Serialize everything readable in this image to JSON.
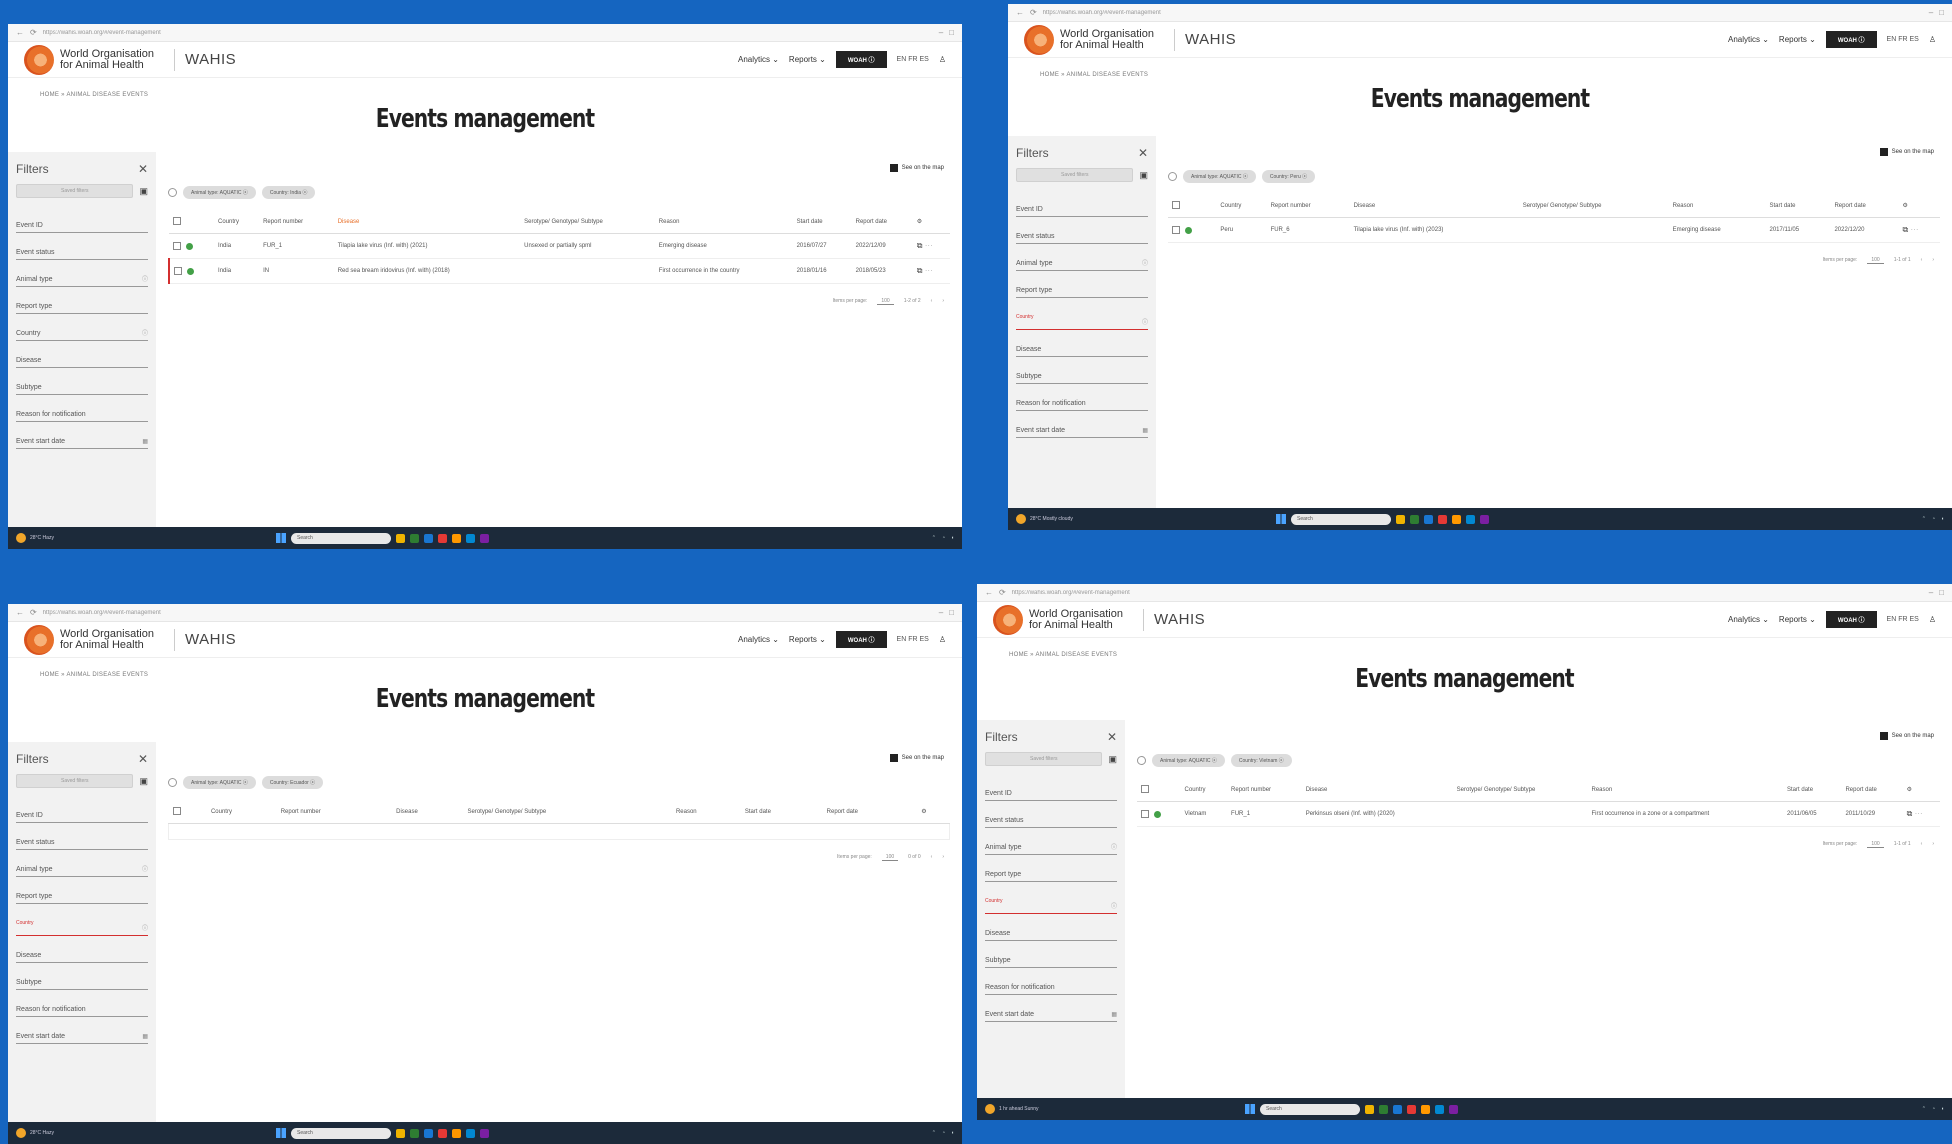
{
  "common": {
    "url": "https://wahis.woah.org/#/event-management",
    "org_name": "World Organisation for Animal Health",
    "app_name": "WAHIS",
    "nav_analytics": "Analytics ⌄",
    "nav_reports": "Reports ⌄",
    "what_is": "WOAH ⓘ",
    "languages": "EN FR ES",
    "breadcrumb": "HOME » ANIMAL DISEASE EVENTS",
    "page_title": "Events management",
    "map_link": "See on the map",
    "filters_title": "Filters",
    "save_filters": "Saved filters",
    "filter_fields": [
      "Event ID",
      "Event status",
      "Animal type",
      "Report type",
      "Country",
      "Disease",
      "Subtype",
      "Reason for notification",
      "Event start date"
    ],
    "active_filter_label": "Country",
    "columns": [
      "Country",
      "Report number",
      "Disease",
      "Serotype/ Genotype/ Subtype",
      "Reason",
      "Start date",
      "Report date"
    ],
    "rows_per_page": "Items per page:",
    "rows_per_page_value": "100",
    "taskbar_search": "Search"
  },
  "panels": [
    {
      "chips": [
        "Animal type: AQUATIC ⓧ",
        "Country: India ⓧ"
      ],
      "rows": [
        {
          "country": "India",
          "report": "FUR_1",
          "disease": "Tilapia lake virus (Inf. with) (2021)",
          "subtype": "Unsexed or partially spml",
          "reason": "Emerging disease",
          "start": "2016/07/27",
          "report_date": "2022/12/09"
        },
        {
          "country": "India",
          "report": "IN",
          "disease": "Red sea bream iridovirus (Inf. with) (2018)",
          "subtype": "",
          "reason": "First occurrence in the country",
          "start": "2018/01/16",
          "report_date": "2018/05/23"
        }
      ],
      "range": "1-2 of 2",
      "taskbar_weather": "28°C Hazy"
    },
    {
      "chips": [
        "Animal type: AQUATIC ⓧ",
        "Country: Peru ⓧ"
      ],
      "rows": [
        {
          "country": "Peru",
          "report": "FUR_6",
          "disease": "Tilapia lake virus (Inf. with) (2023)",
          "subtype": "",
          "reason": "Emerging disease",
          "start": "2017/11/05",
          "report_date": "2022/12/20"
        }
      ],
      "range": "1-1 of 1",
      "taskbar_weather": "28°C Mostly cloudy"
    },
    {
      "chips": [
        "Animal type: AQUATIC ⓧ",
        "Country: Ecuador ⓧ"
      ],
      "rows": [],
      "range": "0 of 0",
      "taskbar_weather": "28°C Hazy"
    },
    {
      "chips": [
        "Animal type: AQUATIC ⓧ",
        "Country: Vietnam ⓧ"
      ],
      "rows": [
        {
          "country": "Vietnam",
          "report": "FUR_1",
          "disease": "Perkinsus olseni (Inf. with) (2020)",
          "subtype": "",
          "reason": "First occurrence in a zone or a compartment",
          "start": "2011/06/05",
          "report_date": "2011/10/29"
        }
      ],
      "range": "1-1 of 1",
      "taskbar_weather": "1 hr ahead Sunny"
    }
  ]
}
